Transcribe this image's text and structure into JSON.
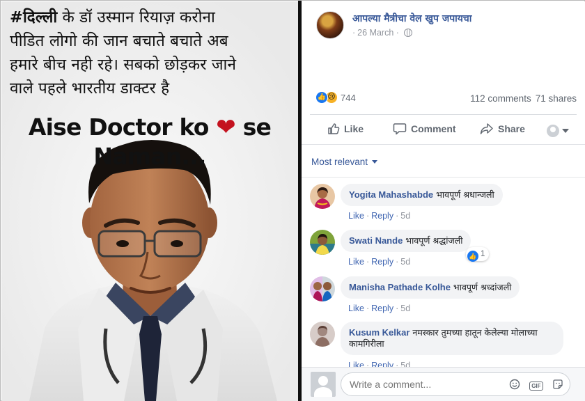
{
  "photo": {
    "hindi_tag": "#दिल्ली",
    "hindi_lines": [
      " के डॉ उस्मान रियाज़ करोना",
      "पीडित लोगो की जान बचाते बचाते अब",
      "हमारे बीच नही रहे। सबको छोड़कर जाने",
      "वाले पहले भारतीय डाक्टर है"
    ],
    "english_line1_a": "Aise Doctor ko ",
    "english_line1_b": " se",
    "english_line2": "Naman..."
  },
  "post": {
    "page_name": "आपल्या मैत्रीचा वेल खुप जपायचा",
    "date": "26 March",
    "reaction_count": "744",
    "comments_label": "112 comments",
    "shares_label": "71 shares"
  },
  "actions": {
    "like": "Like",
    "comment": "Comment",
    "share": "Share"
  },
  "comments_header": {
    "sort_label": "Most relevant"
  },
  "comments": [
    {
      "author": "Yogita Mahashabde",
      "text": "भावपूर्ण श्रधान्जली",
      "like": "Like",
      "reply": "Reply",
      "age": "5d"
    },
    {
      "author": "Swati Nande",
      "text": "भावपूर्ण श्रद्धांजली",
      "like": "Like",
      "reply": "Reply",
      "age": "5d",
      "reactions": "1"
    },
    {
      "author": "Manisha Pathade Kolhe",
      "text": "भावपूर्ण श्रध्दांजली",
      "like": "Like",
      "reply": "Reply",
      "age": "5d"
    },
    {
      "author": "Kusum Kelkar",
      "text": "नमस्कार तुमच्या हातून केलेल्या मोलाच्या कामगिरीला",
      "like": "Like",
      "reply": "Reply",
      "age": "5d"
    }
  ],
  "compose": {
    "placeholder": "Write a comment..."
  },
  "colors": {
    "link_blue": "#385898",
    "fb_blue": "#1877f2",
    "heart_red": "#c4121f"
  }
}
